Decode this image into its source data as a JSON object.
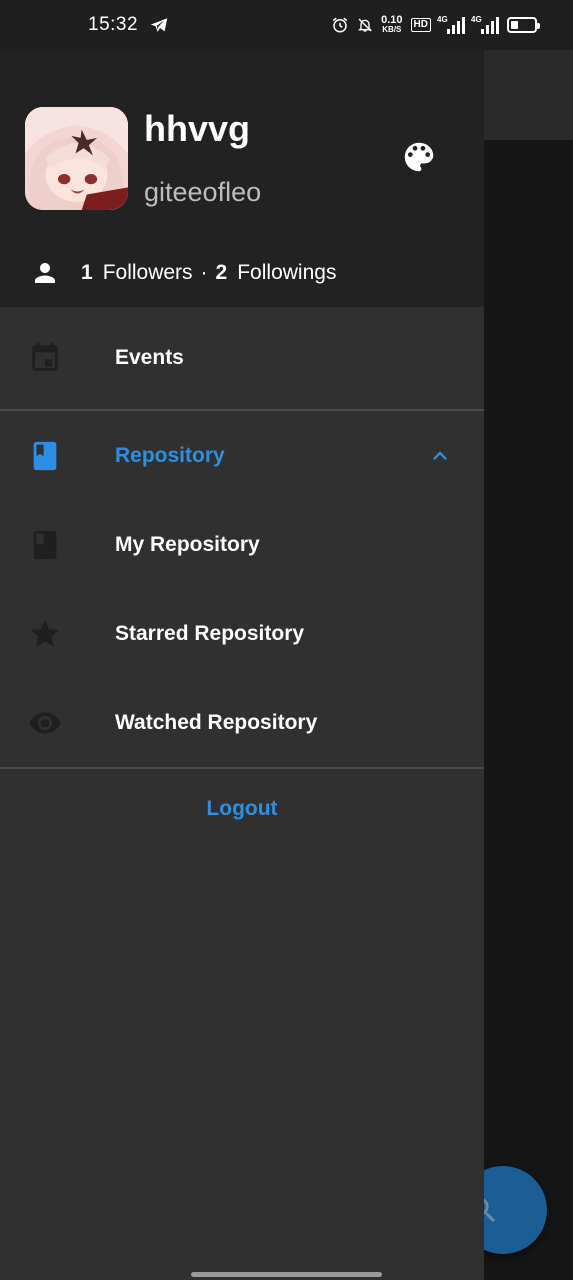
{
  "status_bar": {
    "time": "15:32",
    "net_speed_value": "0.10",
    "net_speed_unit": "KB/S",
    "hd_label": "HD",
    "signal1_label": "4G",
    "signal2_label": "4G",
    "battery_level": 0.3
  },
  "drawer": {
    "user": {
      "name": "hhvvg",
      "login": "giteeofleo"
    },
    "follow": {
      "followers_count": "1",
      "followers_label": "Followers",
      "separator": "·",
      "followings_count": "2",
      "followings_label": "Followings"
    },
    "menu": {
      "events_label": "Events",
      "repository_label": "Repository",
      "my_repository_label": "My Repository",
      "starred_repository_label": "Starred Repository",
      "watched_repository_label": "Watched Repository"
    },
    "logout_label": "Logout"
  },
  "colors": {
    "accent": "#2d8fe3",
    "drawer_bg": "#303030",
    "header_bg": "#222222",
    "icon_muted": "#1f1f1f"
  },
  "icons": {
    "palette": "palette-icon",
    "person": "person-icon",
    "events": "calendar-icon",
    "repository": "book-icon",
    "chevron": "chevron-up-icon",
    "my_repository": "book-icon",
    "starred": "star-icon",
    "watched": "eye-icon",
    "fab": "search-icon"
  }
}
